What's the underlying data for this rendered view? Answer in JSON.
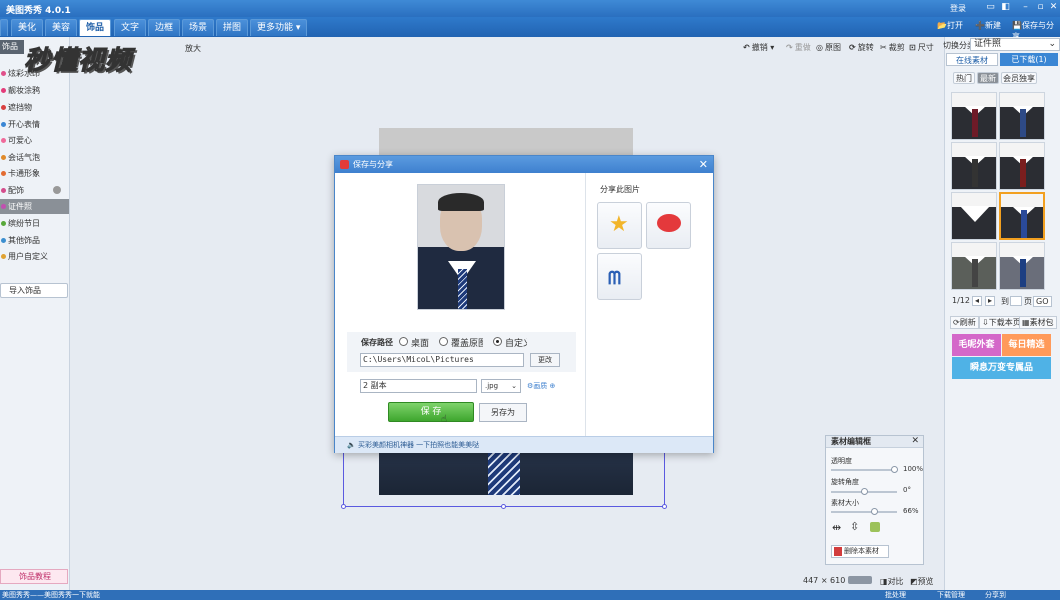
{
  "app": {
    "title": "美图秀秀 4.0.1",
    "login": "登录",
    "top_actions": {
      "open": "打开",
      "new": "新建",
      "save_share": "保存与分享"
    }
  },
  "menu_tabs": [
    {
      "label": "美化"
    },
    {
      "label": "美容"
    },
    {
      "label": "饰品",
      "active": true
    },
    {
      "label": "文字"
    },
    {
      "label": "边框"
    },
    {
      "label": "场景"
    },
    {
      "label": "拼图"
    },
    {
      "label": "更多功能 ▾"
    }
  ],
  "watermark": "秒懂视频",
  "left_panel": {
    "header": "饰品",
    "items": [
      {
        "label": "炫彩水印",
        "icon": "flower-icon",
        "color": "#e0508a"
      },
      {
        "label": "靓妆涂鸦",
        "icon": "heart-icon",
        "color": "#e43c7a"
      },
      {
        "label": "遮挡物",
        "icon": "ban-icon",
        "color": "#d94040"
      },
      {
        "label": "开心表情",
        "icon": "smile-icon",
        "color": "#3a86d4"
      },
      {
        "label": "可爱心",
        "icon": "heart-icon",
        "color": "#f06a9a"
      },
      {
        "label": "会话气泡",
        "icon": "bubble-icon",
        "color": "#e08a2a"
      },
      {
        "label": "卡通形象",
        "icon": "cartoon-icon",
        "color": "#e36c32"
      },
      {
        "label": "配饰",
        "icon": "accessory-icon",
        "color": "#d44d8c"
      },
      {
        "label": "证件照",
        "icon": "id-photo-icon",
        "color": "#c24fb0",
        "selected": true
      },
      {
        "label": "缤纷节日",
        "icon": "festival-icon",
        "color": "#58a83a"
      },
      {
        "label": "其他饰品",
        "icon": "misc-icon",
        "color": "#3c8fd0"
      },
      {
        "label": "用户自定义",
        "icon": "user-icon",
        "color": "#e0a232"
      }
    ],
    "import_button": "导入饰品",
    "tutorial_button": "饰品教程"
  },
  "canvas_toolbar": {
    "zoom_label": "放大",
    "undo": "撤销",
    "redo": "重做",
    "original": "原图",
    "rotate": "旋转",
    "crop": "裁剪",
    "resize": "尺寸"
  },
  "status": {
    "image_size": "447 × 610",
    "compare": "对比",
    "preview": "预览",
    "bottom_text": "美图秀秀——美图秀秀一下就能",
    "bottom_right": [
      "批处理",
      "下载管理",
      "分享到"
    ]
  },
  "right_panel": {
    "category_label": "切换分类",
    "category_value": "证件照",
    "tabs": [
      {
        "label": "在线素材",
        "active": true
      },
      {
        "label": "已下载(1)"
      }
    ],
    "subtabs": [
      {
        "label": "热门"
      },
      {
        "label": "最新",
        "active": true
      },
      {
        "label": "会员独享"
      }
    ],
    "pager": {
      "page": "1/12",
      "goto_label": "到",
      "page_unit": "页",
      "go": "GO"
    },
    "actions": [
      "刷新",
      "下载本页",
      "素材包"
    ],
    "banners": [
      "毛呢外套",
      "每日精选",
      "瞬息万变专属品"
    ]
  },
  "material_panel": {
    "title": "素材编辑框",
    "opacity_label": "透明度",
    "opacity_value": "100%",
    "opacity": 1.0,
    "rotation_label": "旋转角度",
    "rotation_value": "0°",
    "rotation": 0.5,
    "size_label": "素材大小",
    "size_value": "66%",
    "size": 0.66,
    "delete_button": "删除本素材"
  },
  "dialog": {
    "title": "保存与分享",
    "save_path_label": "保存路径",
    "radio_options": [
      {
        "label": "桌面"
      },
      {
        "label": "覆盖原图"
      },
      {
        "label": "自定义",
        "checked": true
      }
    ],
    "path_value": "C:\\Users\\MicoL\\Pictures",
    "change_button": "更改",
    "filename_value": "2 副本",
    "extension_value": ".jpg",
    "quality_label": "画质",
    "save_button": "保 存",
    "save_as_button": "另存为",
    "share_label": "分享此图片",
    "footer_text": "买彩美颜相机神器 一下拍照也能美美哒"
  }
}
